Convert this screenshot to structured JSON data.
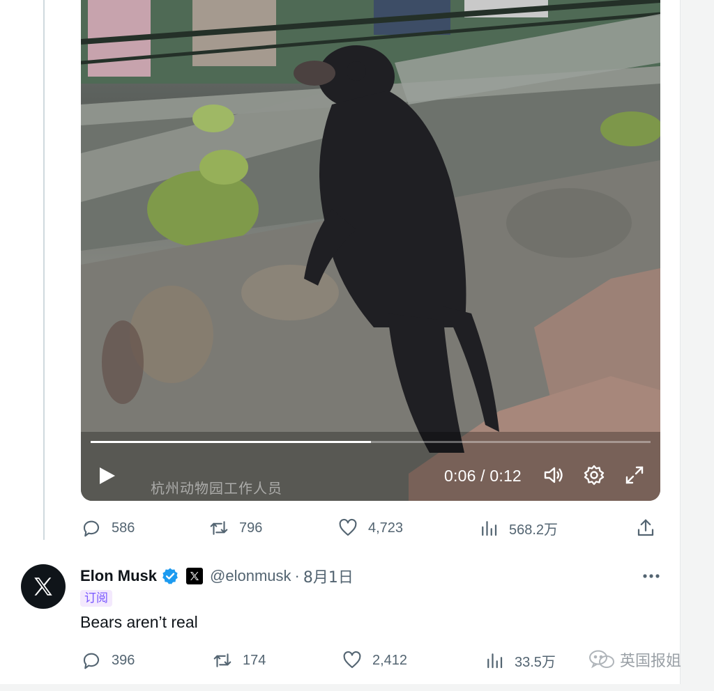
{
  "video": {
    "current_time": "0:06",
    "duration": "0:12",
    "time_separator": " / ",
    "progress": 0.5,
    "caption": "杭州动物园工作人员"
  },
  "retweeted_stats": {
    "replies": "586",
    "reposts": "796",
    "likes": "4,723",
    "views": "568.2万"
  },
  "tweet": {
    "name": "Elon Musk",
    "handle": "@elonmusk",
    "separator": "·",
    "date": "8月1日",
    "subscribe_label": "订阅",
    "text": "Bears aren’t real",
    "stats": {
      "replies": "396",
      "reposts": "174",
      "likes": "2,412",
      "views": "33.5万"
    }
  },
  "watermark": "英国报姐",
  "icons": [
    "play-icon",
    "volume-icon",
    "settings-icon",
    "fullscreen-icon",
    "reply-icon",
    "repost-icon",
    "like-icon",
    "views-icon",
    "share-icon",
    "verified-icon",
    "x-logo-icon",
    "more-icon",
    "wechat-icon"
  ],
  "colors": {
    "text": "#0f1419",
    "secondary": "#536471",
    "verified": "#1d9bf0",
    "subscribe_bg": "#f3e9fd",
    "subscribe_text": "#7856ff"
  }
}
